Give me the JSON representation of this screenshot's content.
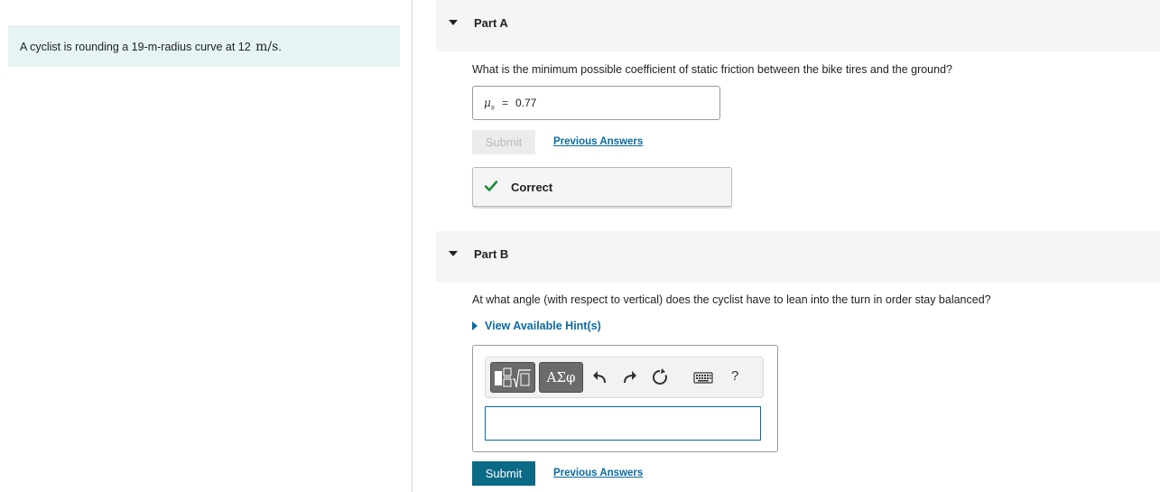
{
  "intro": {
    "text": "A cyclist is rounding a 19-m-radius curve at 12",
    "units": "m/s",
    "period": "."
  },
  "partA": {
    "title": "Part A",
    "question": "What is the minimum possible coefficient of static friction between the bike tires and the ground?",
    "answer_symbol": "μ",
    "answer_subscript": "s",
    "answer_equals": "=",
    "answer_value": "0.77",
    "submit_label": "Submit",
    "previous_answers_label": "Previous Answers",
    "feedback_label": "Correct"
  },
  "partB": {
    "title": "Part B",
    "question": "At what angle (with respect to vertical) does the cyclist have to lean into the turn in order stay balanced?",
    "hint_label": "View Available Hint(s)",
    "greek_button_label": "ΑΣφ",
    "help_label": "?",
    "answer_value": "",
    "submit_label": "Submit",
    "previous_answers_label": "Previous Answers"
  },
  "colors": {
    "link": "#0b6aa1",
    "submit_active": "#0b6a85",
    "correct_check": "#1e8a3c",
    "intro_bg": "#e6f4f4"
  },
  "icons": [
    "caret-down-icon",
    "checkmark-icon",
    "hint-triangle-icon",
    "templates-icon",
    "undo-icon",
    "redo-icon",
    "reset-icon",
    "keyboard-icon",
    "help-icon"
  ]
}
